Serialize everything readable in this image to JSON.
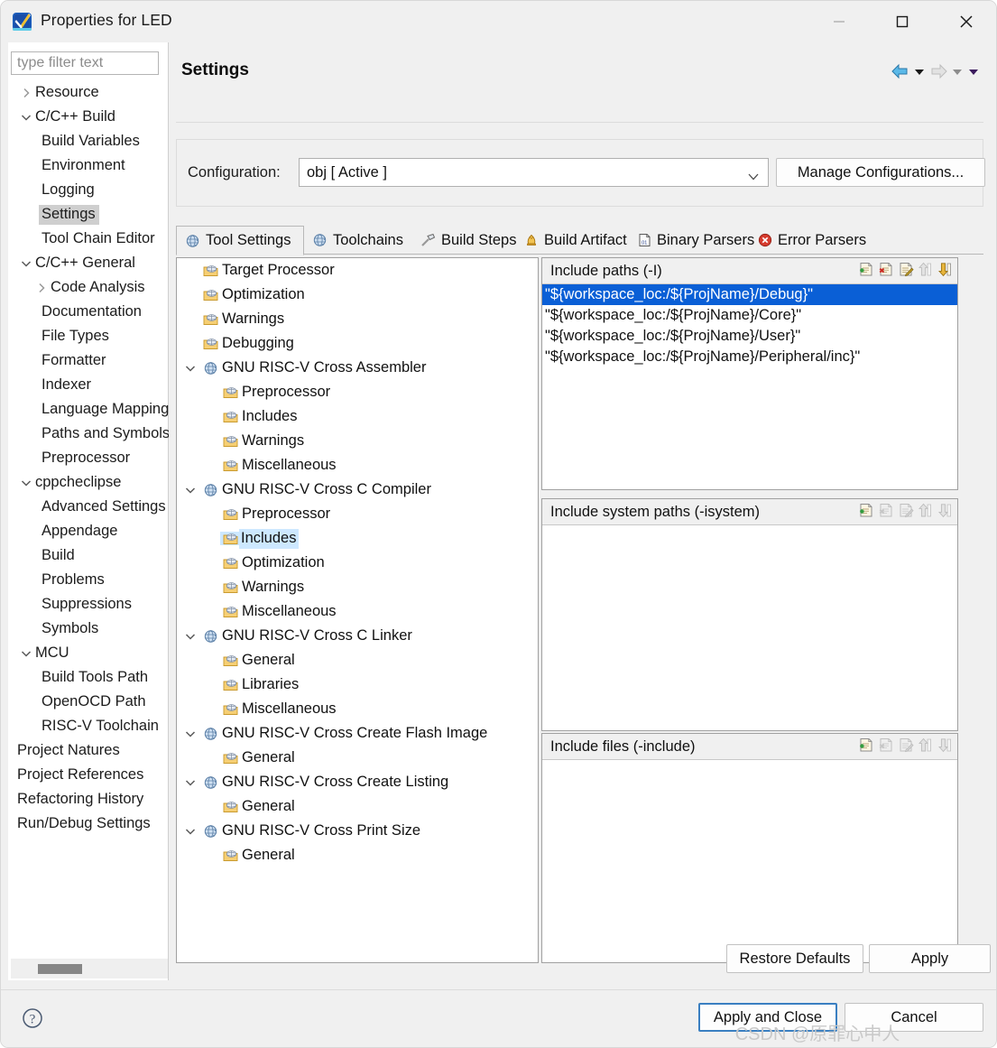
{
  "window": {
    "title": "Properties for LED",
    "app_icon": "checkmark-app-icon",
    "controls": {
      "minimize": "minimize-icon",
      "maximize": "maximize-icon",
      "close": "close-icon"
    }
  },
  "sidebar": {
    "filter_placeholder": "type filter text",
    "filter_value": "",
    "selected": "Settings",
    "items": [
      {
        "label": "Resource",
        "level": 0,
        "twisty": "collapsed"
      },
      {
        "label": "C/C++ Build",
        "level": 0,
        "twisty": "expanded"
      },
      {
        "label": "Build Variables",
        "level": 1,
        "twisty": "none"
      },
      {
        "label": "Environment",
        "level": 1,
        "twisty": "none"
      },
      {
        "label": "Logging",
        "level": 1,
        "twisty": "none"
      },
      {
        "label": "Settings",
        "level": 1,
        "twisty": "none",
        "selected": true
      },
      {
        "label": "Tool Chain Editor",
        "level": 1,
        "twisty": "none"
      },
      {
        "label": "C/C++ General",
        "level": 0,
        "twisty": "expanded"
      },
      {
        "label": "Code Analysis",
        "level": 1,
        "twisty": "collapsed"
      },
      {
        "label": "Documentation",
        "level": 1,
        "twisty": "none"
      },
      {
        "label": "File Types",
        "level": 1,
        "twisty": "none"
      },
      {
        "label": "Formatter",
        "level": 1,
        "twisty": "none"
      },
      {
        "label": "Indexer",
        "level": 1,
        "twisty": "none"
      },
      {
        "label": "Language Mappings",
        "level": 1,
        "twisty": "none"
      },
      {
        "label": "Paths and Symbols",
        "level": 1,
        "twisty": "none"
      },
      {
        "label": "Preprocessor",
        "level": 1,
        "twisty": "none"
      },
      {
        "label": "cppcheclipse",
        "level": 0,
        "twisty": "expanded"
      },
      {
        "label": "Advanced Settings",
        "level": 1,
        "twisty": "none"
      },
      {
        "label": "Appendage",
        "level": 1,
        "twisty": "none"
      },
      {
        "label": "Build",
        "level": 1,
        "twisty": "none"
      },
      {
        "label": "Problems",
        "level": 1,
        "twisty": "none"
      },
      {
        "label": "Suppressions",
        "level": 1,
        "twisty": "none"
      },
      {
        "label": "Symbols",
        "level": 1,
        "twisty": "none"
      },
      {
        "label": "MCU",
        "level": 0,
        "twisty": "expanded"
      },
      {
        "label": "Build Tools Path",
        "level": 1,
        "twisty": "none"
      },
      {
        "label": "OpenOCD Path",
        "level": 1,
        "twisty": "none"
      },
      {
        "label": "RISC-V Toolchain",
        "level": 1,
        "twisty": "none"
      },
      {
        "label": "Project Natures",
        "level": 0,
        "twisty": "none"
      },
      {
        "label": "Project References",
        "level": 0,
        "twisty": "none"
      },
      {
        "label": "Refactoring History",
        "level": 0,
        "twisty": "none"
      },
      {
        "label": "Run/Debug Settings",
        "level": 0,
        "twisty": "none"
      }
    ],
    "scrollbar": "horizontal-scrollbar"
  },
  "header": {
    "page_title": "Settings",
    "nav": [
      {
        "name": "back-arrow-icon",
        "state": "enabled"
      },
      {
        "name": "back-dropdown-icon",
        "state": "enabled"
      },
      {
        "name": "forward-arrow-icon",
        "state": "disabled"
      },
      {
        "name": "forward-dropdown-icon",
        "state": "disabled"
      },
      {
        "name": "menu-dropdown-icon",
        "state": "enabled"
      }
    ]
  },
  "configuration": {
    "label": "Configuration:",
    "value": "obj  [ Active ]",
    "options": [
      "obj  [ Active ]"
    ],
    "manage_button": "Manage Configurations..."
  },
  "tabs": [
    {
      "label": "Tool Settings",
      "icon": "wrench-gear-icon",
      "active": true
    },
    {
      "label": "Toolchains",
      "icon": "wrench-gear-icon",
      "active": false
    },
    {
      "label": "Build Steps",
      "icon": "hammer-icon",
      "active": false
    },
    {
      "label": "Build Artifact",
      "icon": "artifact-icon",
      "active": false
    },
    {
      "label": "Binary Parsers",
      "icon": "binary-file-icon",
      "active": false
    },
    {
      "label": "Error Parsers",
      "icon": "error-circle-icon",
      "active": false
    }
  ],
  "tool_tree": {
    "selected": "Includes",
    "nodes": [
      {
        "label": "Target Processor",
        "kind": "leaf",
        "depth": 1
      },
      {
        "label": "Optimization",
        "kind": "leaf",
        "depth": 1
      },
      {
        "label": "Warnings",
        "kind": "leaf",
        "depth": 1
      },
      {
        "label": "Debugging",
        "kind": "leaf",
        "depth": 1
      },
      {
        "label": "GNU RISC-V Cross Assembler",
        "kind": "category",
        "depth": 0,
        "twisty": "expanded"
      },
      {
        "label": "Preprocessor",
        "kind": "leaf",
        "depth": 2
      },
      {
        "label": "Includes",
        "kind": "leaf",
        "depth": 2
      },
      {
        "label": "Warnings",
        "kind": "leaf",
        "depth": 2
      },
      {
        "label": "Miscellaneous",
        "kind": "leaf",
        "depth": 2
      },
      {
        "label": "GNU RISC-V Cross C Compiler",
        "kind": "category",
        "depth": 0,
        "twisty": "expanded"
      },
      {
        "label": "Preprocessor",
        "kind": "leaf",
        "depth": 2
      },
      {
        "label": "Includes",
        "kind": "leaf",
        "depth": 2,
        "selected": true
      },
      {
        "label": "Optimization",
        "kind": "leaf",
        "depth": 2
      },
      {
        "label": "Warnings",
        "kind": "leaf",
        "depth": 2
      },
      {
        "label": "Miscellaneous",
        "kind": "leaf",
        "depth": 2
      },
      {
        "label": "GNU RISC-V Cross C Linker",
        "kind": "category",
        "depth": 0,
        "twisty": "expanded"
      },
      {
        "label": "General",
        "kind": "leaf",
        "depth": 2
      },
      {
        "label": "Libraries",
        "kind": "leaf",
        "depth": 2
      },
      {
        "label": "Miscellaneous",
        "kind": "leaf",
        "depth": 2
      },
      {
        "label": "GNU RISC-V Cross Create Flash Image",
        "kind": "category",
        "depth": 0,
        "twisty": "expanded"
      },
      {
        "label": "General",
        "kind": "leaf",
        "depth": 2
      },
      {
        "label": "GNU RISC-V Cross Create Listing",
        "kind": "category",
        "depth": 0,
        "twisty": "expanded"
      },
      {
        "label": "General",
        "kind": "leaf",
        "depth": 2
      },
      {
        "label": "GNU RISC-V Cross Print Size",
        "kind": "category",
        "depth": 0,
        "twisty": "expanded"
      },
      {
        "label": "General",
        "kind": "leaf",
        "depth": 2
      }
    ]
  },
  "panels": [
    {
      "title": "Include paths (-I)",
      "tools": [
        {
          "name": "add-icon",
          "state": "enabled"
        },
        {
          "name": "delete-icon",
          "state": "enabled"
        },
        {
          "name": "edit-icon",
          "state": "enabled"
        },
        {
          "name": "move-up-icon",
          "state": "disabled"
        },
        {
          "name": "move-down-icon",
          "state": "enabled"
        }
      ],
      "rows": [
        {
          "text": "\"${workspace_loc:/${ProjName}/Debug}\"",
          "selected": true
        },
        {
          "text": "\"${workspace_loc:/${ProjName}/Core}\"",
          "selected": false
        },
        {
          "text": "\"${workspace_loc:/${ProjName}/User}\"",
          "selected": false
        },
        {
          "text": "\"${workspace_loc:/${ProjName}/Peripheral/inc}\"",
          "selected": false
        }
      ]
    },
    {
      "title": "Include system paths (-isystem)",
      "tools": [
        {
          "name": "add-icon",
          "state": "enabled"
        },
        {
          "name": "delete-icon",
          "state": "disabled"
        },
        {
          "name": "edit-icon",
          "state": "disabled"
        },
        {
          "name": "move-up-icon",
          "state": "disabled"
        },
        {
          "name": "move-down-icon",
          "state": "disabled"
        }
      ],
      "rows": []
    },
    {
      "title": "Include files (-include)",
      "tools": [
        {
          "name": "add-icon",
          "state": "enabled"
        },
        {
          "name": "delete-icon",
          "state": "disabled"
        },
        {
          "name": "edit-icon",
          "state": "disabled"
        },
        {
          "name": "move-up-icon",
          "state": "disabled"
        },
        {
          "name": "move-down-icon",
          "state": "disabled"
        }
      ],
      "rows": []
    }
  ],
  "buttons": {
    "restore_defaults": "Restore Defaults",
    "apply": "Apply",
    "apply_and_close": "Apply and Close",
    "cancel": "Cancel",
    "help": "help-icon"
  },
  "watermark": "CSDN @原罪心中人",
  "colors": {
    "selection_blue": "#0a5fd6",
    "tree_selection": "#cde8ff",
    "sidebar_selection": "#cfcfcf",
    "focus_border": "#3a7fc1",
    "window_bg": "#f0f0f0",
    "accent_yellow": "#e8b53c"
  }
}
